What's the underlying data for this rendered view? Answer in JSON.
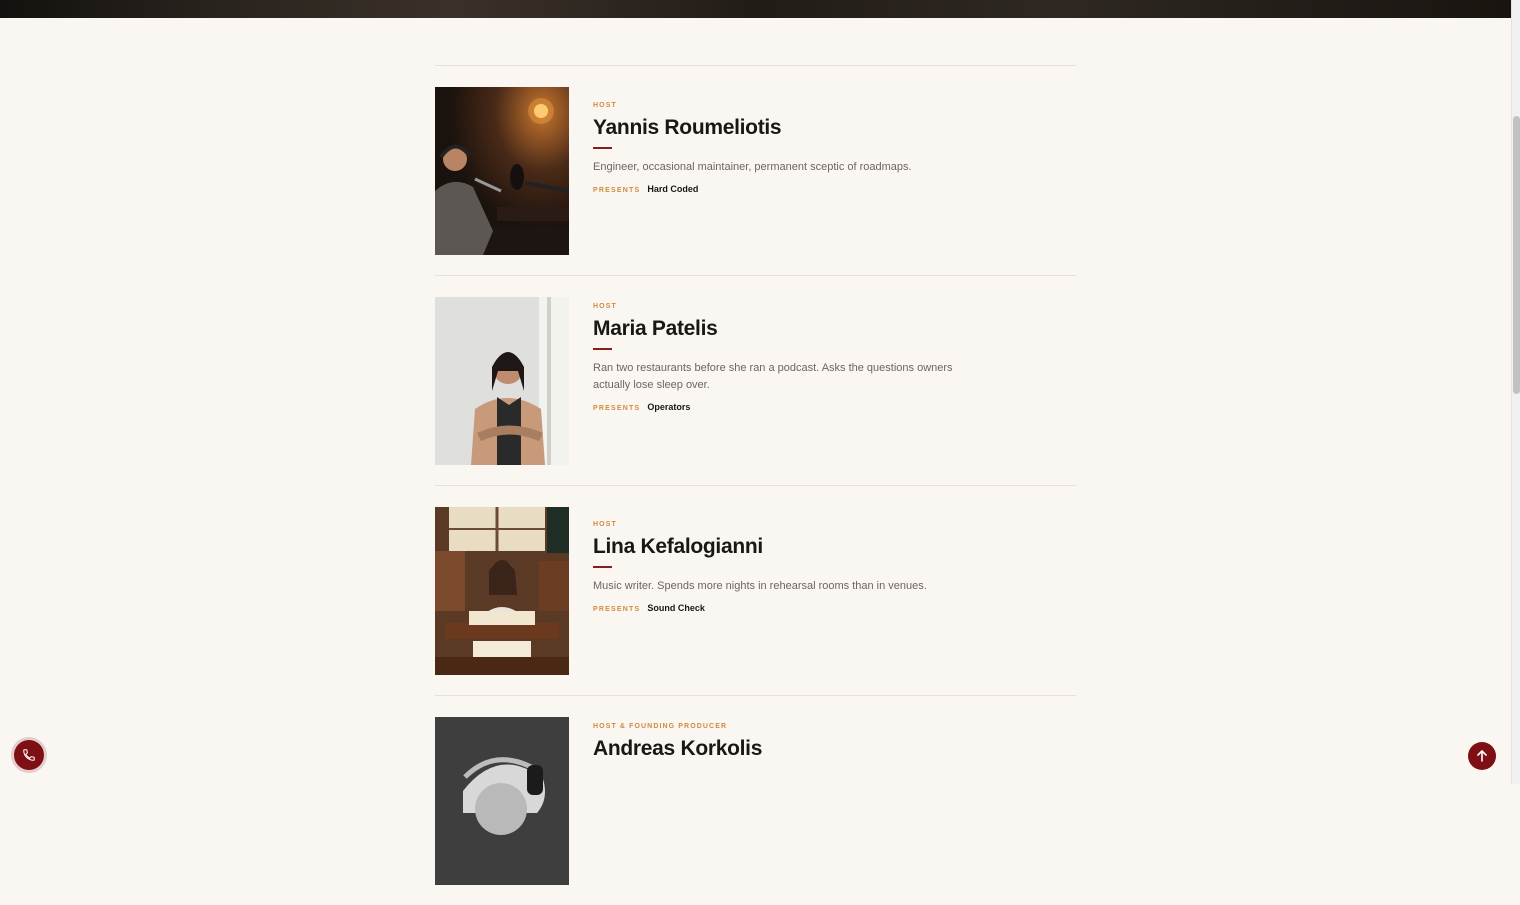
{
  "hosts": [
    {
      "role": "HOST",
      "name": "Yannis Roumeliotis",
      "bio": "Engineer, occasional maintainer, permanent sceptic of roadmaps.",
      "presents_label": "PRESENTS",
      "show": "Hard Coded"
    },
    {
      "role": "HOST",
      "name": "Maria Patelis",
      "bio": "Ran two restaurants before she ran a podcast. Asks the questions owners actually lose sleep over.",
      "presents_label": "PRESENTS",
      "show": "Operators"
    },
    {
      "role": "HOST",
      "name": "Lina Kefalogianni",
      "bio": "Music writer. Spends more nights in rehearsal rooms than in venues.",
      "presents_label": "PRESENTS",
      "show": "Sound Check"
    },
    {
      "role": "HOST & FOUNDING PRODUCER",
      "name": "Andreas Korkolis"
    }
  ],
  "colors": {
    "accent": "#8a1c1c",
    "label": "#d28a3a",
    "background": "#faf7f3"
  },
  "icons": {
    "phone": "phone-icon",
    "back_to_top": "arrow-up-icon"
  }
}
